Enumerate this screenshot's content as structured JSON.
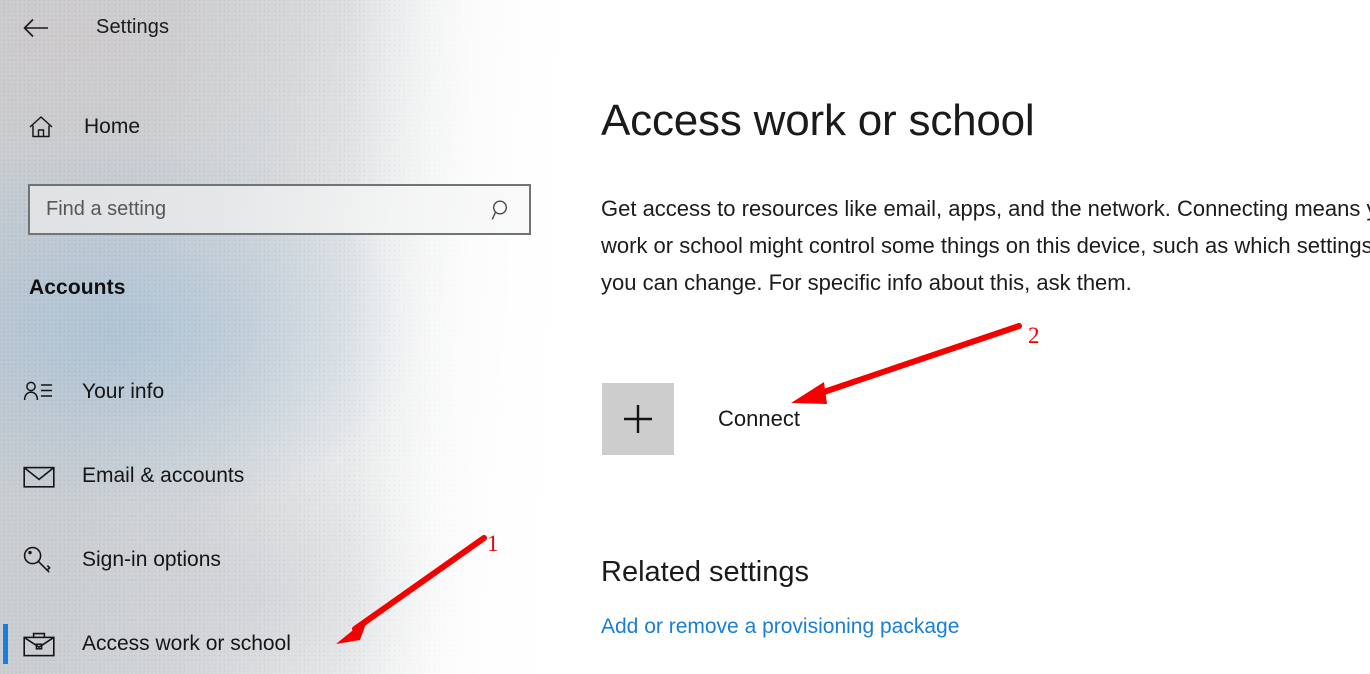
{
  "window": {
    "title": "Settings",
    "back_icon": "back-arrow-icon"
  },
  "sidebar": {
    "home": {
      "label": "Home",
      "icon": "home-icon"
    },
    "search": {
      "value": "",
      "placeholder": "Find a setting",
      "icon": "search-icon"
    },
    "section_header": "Accounts",
    "items": [
      {
        "label": "Your info",
        "icon": "user-info-icon",
        "selected": false
      },
      {
        "label": "Email & accounts",
        "icon": "envelope-icon",
        "selected": false
      },
      {
        "label": "Sign-in options",
        "icon": "key-icon",
        "selected": false
      },
      {
        "label": "Access work or school",
        "icon": "briefcase-icon",
        "selected": true
      }
    ]
  },
  "main": {
    "title": "Access work or school",
    "description": "Get access to resources like email, apps, and the network. Connecting means your work or school might control some things on this device, such as which settings you can change. For specific info about this, ask them.",
    "connect": {
      "label": "Connect",
      "icon": "plus-icon"
    },
    "related": {
      "heading": "Related settings",
      "links": [
        {
          "label": "Add or remove a provisioning package"
        }
      ]
    }
  },
  "annotations": [
    {
      "number": "1",
      "target": "sidebar-item-access-work-or-school"
    },
    {
      "number": "2",
      "target": "connect-button"
    }
  ],
  "colors": {
    "accent": "#1a7ede",
    "link": "#1a7ed6",
    "annotation": "#f50000",
    "connect_box": "#cdcdcd"
  }
}
